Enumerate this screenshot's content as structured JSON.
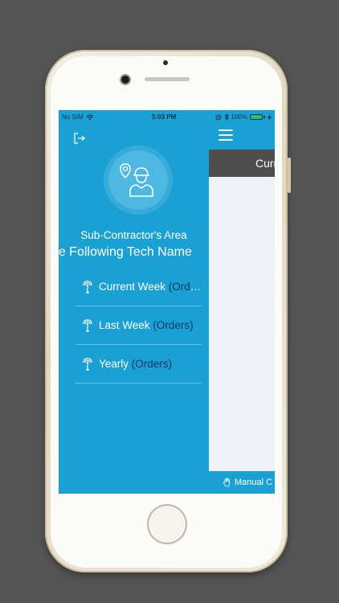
{
  "status_bar": {
    "carrier": "No SIM",
    "time": "5:03 PM",
    "battery": "100%",
    "battery_color": "#2ecc40"
  },
  "drawer": {
    "background_color": "#1ba0d4",
    "area_title": "Sub-Contractor's Area",
    "tech_name": "The Following Tech Name",
    "menu_items": [
      {
        "label": "Current Week",
        "suffix": "(Orders)",
        "icon": "antenna-icon"
      },
      {
        "label": "Last Week",
        "suffix": "(Orders)",
        "icon": "antenna-icon"
      },
      {
        "label": "Yearly",
        "suffix": "(Orders)",
        "icon": "antenna-icon"
      }
    ]
  },
  "main": {
    "subbar_title": "Current",
    "footer_label": "Manual C"
  },
  "colors": {
    "accent": "#1ba0d4",
    "paren_text": "#0d3c66",
    "subbar": "#4e4e4e",
    "page_background": "#555555"
  }
}
